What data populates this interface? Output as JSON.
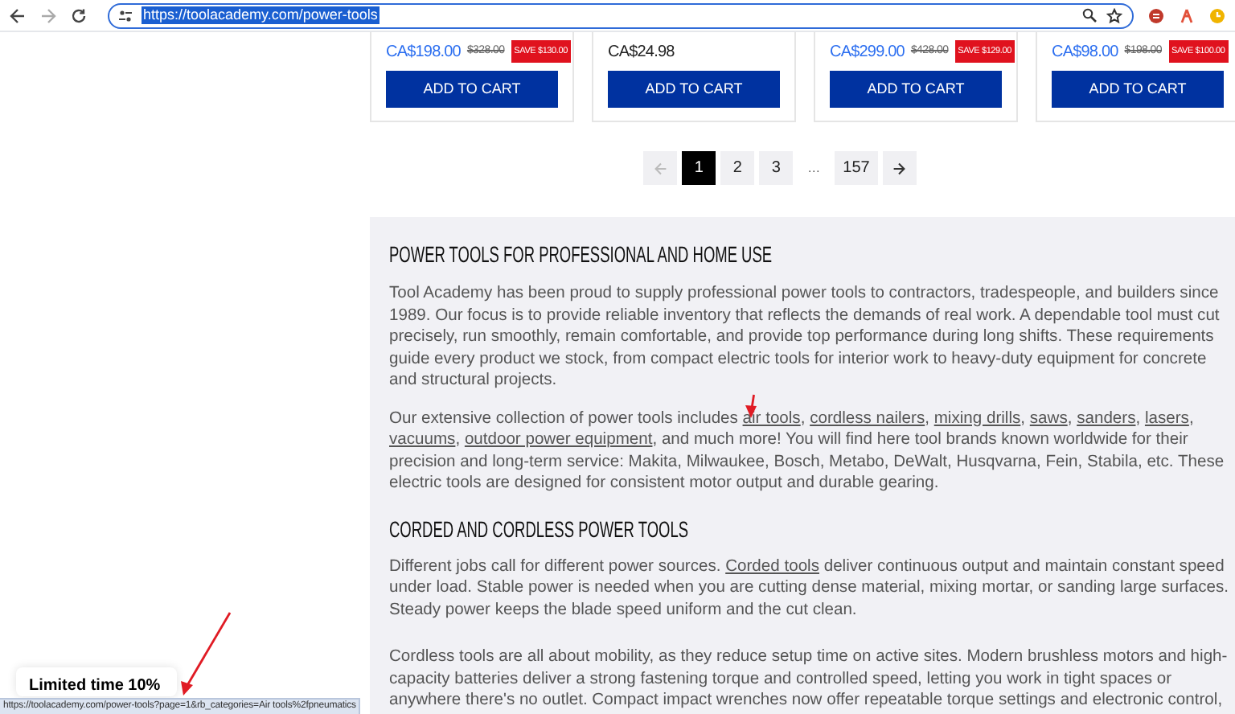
{
  "browser": {
    "url": "https://toolacademy.com/power-tools",
    "url_selected": true,
    "status_url": "https://toolacademy.com/power-tools?page=1&rb_categories=Air tools%2fpneumatics"
  },
  "products": [
    {
      "price": "CA$198.00",
      "sale": true,
      "old_price": "$328.00",
      "save": "SAVE $130.00",
      "button": "ADD TO CART"
    },
    {
      "price": "CA$24.98",
      "sale": false,
      "button": "ADD TO CART"
    },
    {
      "price": "CA$299.00",
      "sale": true,
      "old_price": "$428.00",
      "save": "SAVE $129.00",
      "button": "ADD TO CART"
    },
    {
      "price": "CA$98.00",
      "sale": true,
      "old_price": "$198.00",
      "save": "SAVE $100.00",
      "button": "ADD TO CART"
    }
  ],
  "pagination": [
    {
      "kind": "prev",
      "disabled": true
    },
    {
      "kind": "page",
      "label": "1",
      "selected": true
    },
    {
      "kind": "page",
      "label": "2",
      "selected": false
    },
    {
      "kind": "page",
      "label": "3",
      "selected": false
    },
    {
      "kind": "ellipsis",
      "label": "…"
    },
    {
      "kind": "page",
      "label": "157",
      "selected": false
    },
    {
      "kind": "next",
      "disabled": false
    }
  ],
  "sections": [
    {
      "heading": "POWER TOOLS FOR PROFESSIONAL AND HOME USE",
      "paragraphs": [
        [
          {
            "text": "Tool Academy has been proud to supply professional power tools to contractors, tradespeople, and builders since 1989. Our focus is to provide reliable inventory that reflects the demands of real work. A dependable tool must cut precisely, run smoothly, remain comfortable, and provide top performance during long shifts. These requirements guide every product we stock, from compact electric tools for interior work to heavy-duty equipment for concrete and structural projects."
          }
        ],
        [
          {
            "text": "Our extensive collection of power tools includes "
          },
          {
            "text": "air tools",
            "link": true
          },
          {
            "text": ", "
          },
          {
            "text": "cordless nailers",
            "link": true
          },
          {
            "text": ", "
          },
          {
            "text": "mixing drills",
            "link": true
          },
          {
            "text": ", "
          },
          {
            "text": "saws",
            "link": true
          },
          {
            "text": ", "
          },
          {
            "text": "sanders",
            "link": true
          },
          {
            "text": ", "
          },
          {
            "text": "lasers",
            "link": true
          },
          {
            "text": ", "
          },
          {
            "text": "vacuums",
            "link": true
          },
          {
            "text": ", "
          },
          {
            "text": "outdoor power equipment",
            "link": true
          },
          {
            "text": ", and much more! You will find here tool brands known worldwide for their precision and long-term service: Makita, Milwaukee, Bosch, Metabo, DeWalt, Husqvarna, Fein, Stabila, etc. These electric tools are designed for consistent motor output and durable gearing."
          }
        ]
      ]
    },
    {
      "heading": "CORDED AND CORDLESS POWER TOOLS",
      "paragraphs": [
        [
          {
            "text": "Different jobs call for different power sources. "
          },
          {
            "text": "Corded tools",
            "link": true
          },
          {
            "text": " deliver continuous output and maintain constant speed under load. Stable power is needed when you are cutting dense material, mixing mortar, or sanding large surfaces. Steady power keeps the blade speed uniform and the cut clean."
          }
        ],
        [
          {
            "text": "Cordless tools are all about mobility, as they reduce setup time on active sites. Modern brushless motors and high-capacity batteries deliver a strong fastening torque and controlled speed, letting you work in tight spaces or anywhere there's no outlet. Compact impact wrenches now offer repeatable torque settings and electronic control,"
          }
        ]
      ]
    }
  ],
  "promo": {
    "text": "Limited time 10%"
  }
}
